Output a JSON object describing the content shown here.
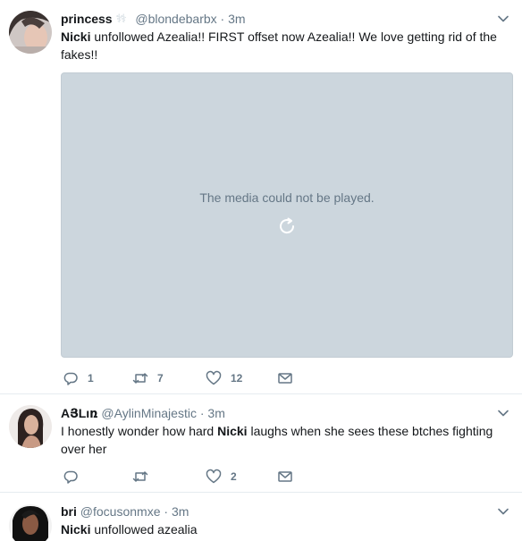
{
  "tweets": [
    {
      "name": "princess",
      "emoji": "⚕⚕",
      "handle": "@blondebarbx",
      "separator": "·",
      "time": "3m",
      "mention": "Nicki",
      "text_rest": " unfollowed Azealia!! FIRST offset now Azealia!! We love getting rid of the fakes!!",
      "media_message": "The media could not be played.",
      "reply_count": "1",
      "retweet_count": "7",
      "like_count": "12"
    },
    {
      "name": "AՅLıռ",
      "handle": "@AylinMinajestic",
      "separator": "·",
      "time": "3m",
      "text_before": "I honestly wonder how hard ",
      "mention": "Nicki",
      "text_after": " laughs when she sees these btches fighting over her",
      "reply_count": "",
      "retweet_count": "",
      "like_count": "2"
    },
    {
      "name": "bri",
      "handle": "@focusonmxe",
      "separator": "·",
      "time": "3m",
      "mention": "Nicki",
      "text_rest": " unfollowed azealia"
    }
  ],
  "icons": {
    "reply": "reply-icon",
    "retweet": "retweet-icon",
    "like": "heart-icon",
    "dm": "envelope-icon",
    "caret": "chevron-down-icon"
  },
  "colors": {
    "icon_gray": "#657786",
    "media_bg": "#ccd6dd",
    "divider": "#e6ecf0"
  }
}
